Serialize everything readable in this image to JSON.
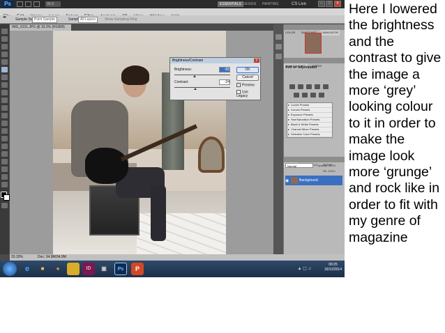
{
  "photoshop": {
    "logo": "Ps",
    "zoom_level": "33.3",
    "workspaces": [
      "ESSENTIALS",
      "DESIGN",
      "PAINTING"
    ],
    "active_workspace": "ESSENTIALS",
    "cs_live": "CS Live",
    "menu": [
      "File",
      "Edit",
      "Image",
      "Layer",
      "Select",
      "Filter",
      "Analysis",
      "3D",
      "View",
      "Window",
      "Help"
    ],
    "options_bar": {
      "sample_size_label": "Sample Size:",
      "sample_size_value": "Point Sample",
      "sample_label": "Sample:",
      "sample_value": "All Layers",
      "show_ring": "Show Sampling Ring"
    },
    "document_tab": "IMG_6311.JPG @ 33.3% (RGB/8)",
    "status_zoom": "33.33%",
    "status_doc": "Doc: 34.9M/34.9M"
  },
  "dialog": {
    "title": "Brightness/Contrast",
    "brightness_label": "Brightness:",
    "brightness_value": "-82",
    "contrast_label": "Contrast:",
    "contrast_value": "-24",
    "brightness_level": 0.36,
    "contrast_level": 0.38,
    "ok_label": "OK",
    "cancel_label": "Cancel",
    "preview_label": "Preview",
    "legacy_label": "Use Legacy"
  },
  "panels": {
    "top_tabs": [
      "COLOR",
      "SWATCHES",
      "NAVIGATOR"
    ],
    "active_top_tab": "NAVIGATOR",
    "adj_tabs": [
      "ADJUSTMENTS",
      "MASKS"
    ],
    "adj_title": "Add an adjustment",
    "presets": [
      "Levels Presets",
      "Curves Presets",
      "Exposure Presets",
      "Hue/Saturation Presets",
      "Black & White Presets",
      "Channel Mixer Presets",
      "Selective Color Presets"
    ],
    "layer_tabs": [
      "LAYERS",
      "CHANNELS",
      "PATHS"
    ],
    "blend_mode": "Normal",
    "opacity": "Opacity: 100%",
    "fill": "Fill: 100%",
    "layer_name": "Background"
  },
  "taskbar": {
    "apps": [
      "e",
      "■",
      "●",
      "ID",
      "▣",
      "Ps",
      "P"
    ],
    "time": "09:25",
    "date": "16/12/2014"
  },
  "note_text": "Here I lowered the brightness and the contrast to give the image a more ‘grey’ looking colour to it in order to make the image look more ‘grunge’ and rock like in order to fit with my genre of magazine",
  "colors": {
    "accent": "#3b6fc1",
    "ps_dark": "#2b2b2b",
    "close_red": "#c8402f"
  }
}
